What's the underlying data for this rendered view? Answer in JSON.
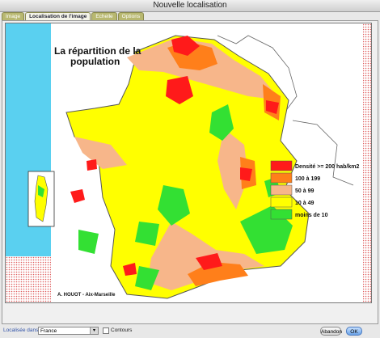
{
  "window": {
    "title": "Nouvelle localisation"
  },
  "tabs": [
    {
      "label": "Image"
    },
    {
      "label": "Localisation de l'image"
    },
    {
      "label": "Echelle"
    },
    {
      "label": "Options"
    }
  ],
  "map": {
    "title_line1": "La répartition de la",
    "title_line2": "population",
    "credit": "A. HOUOT - Aix-Marseille",
    "legend": [
      {
        "label": "Densité >= 200 hab/km2",
        "color": "#ff1a1a"
      },
      {
        "label": "100 à 199",
        "color": "#ff7f1a"
      },
      {
        "label": "50 à 99",
        "color": "#f7b68a"
      },
      {
        "label": "10 à 49",
        "color": "#ffff00"
      },
      {
        "label": "moins de 10",
        "color": "#33e033"
      }
    ]
  },
  "footer": {
    "localise_label": "Localisée dans",
    "country_value": "France",
    "contours_label": "Contours",
    "abandon_label": "Abandon",
    "ok_label": "OK"
  }
}
